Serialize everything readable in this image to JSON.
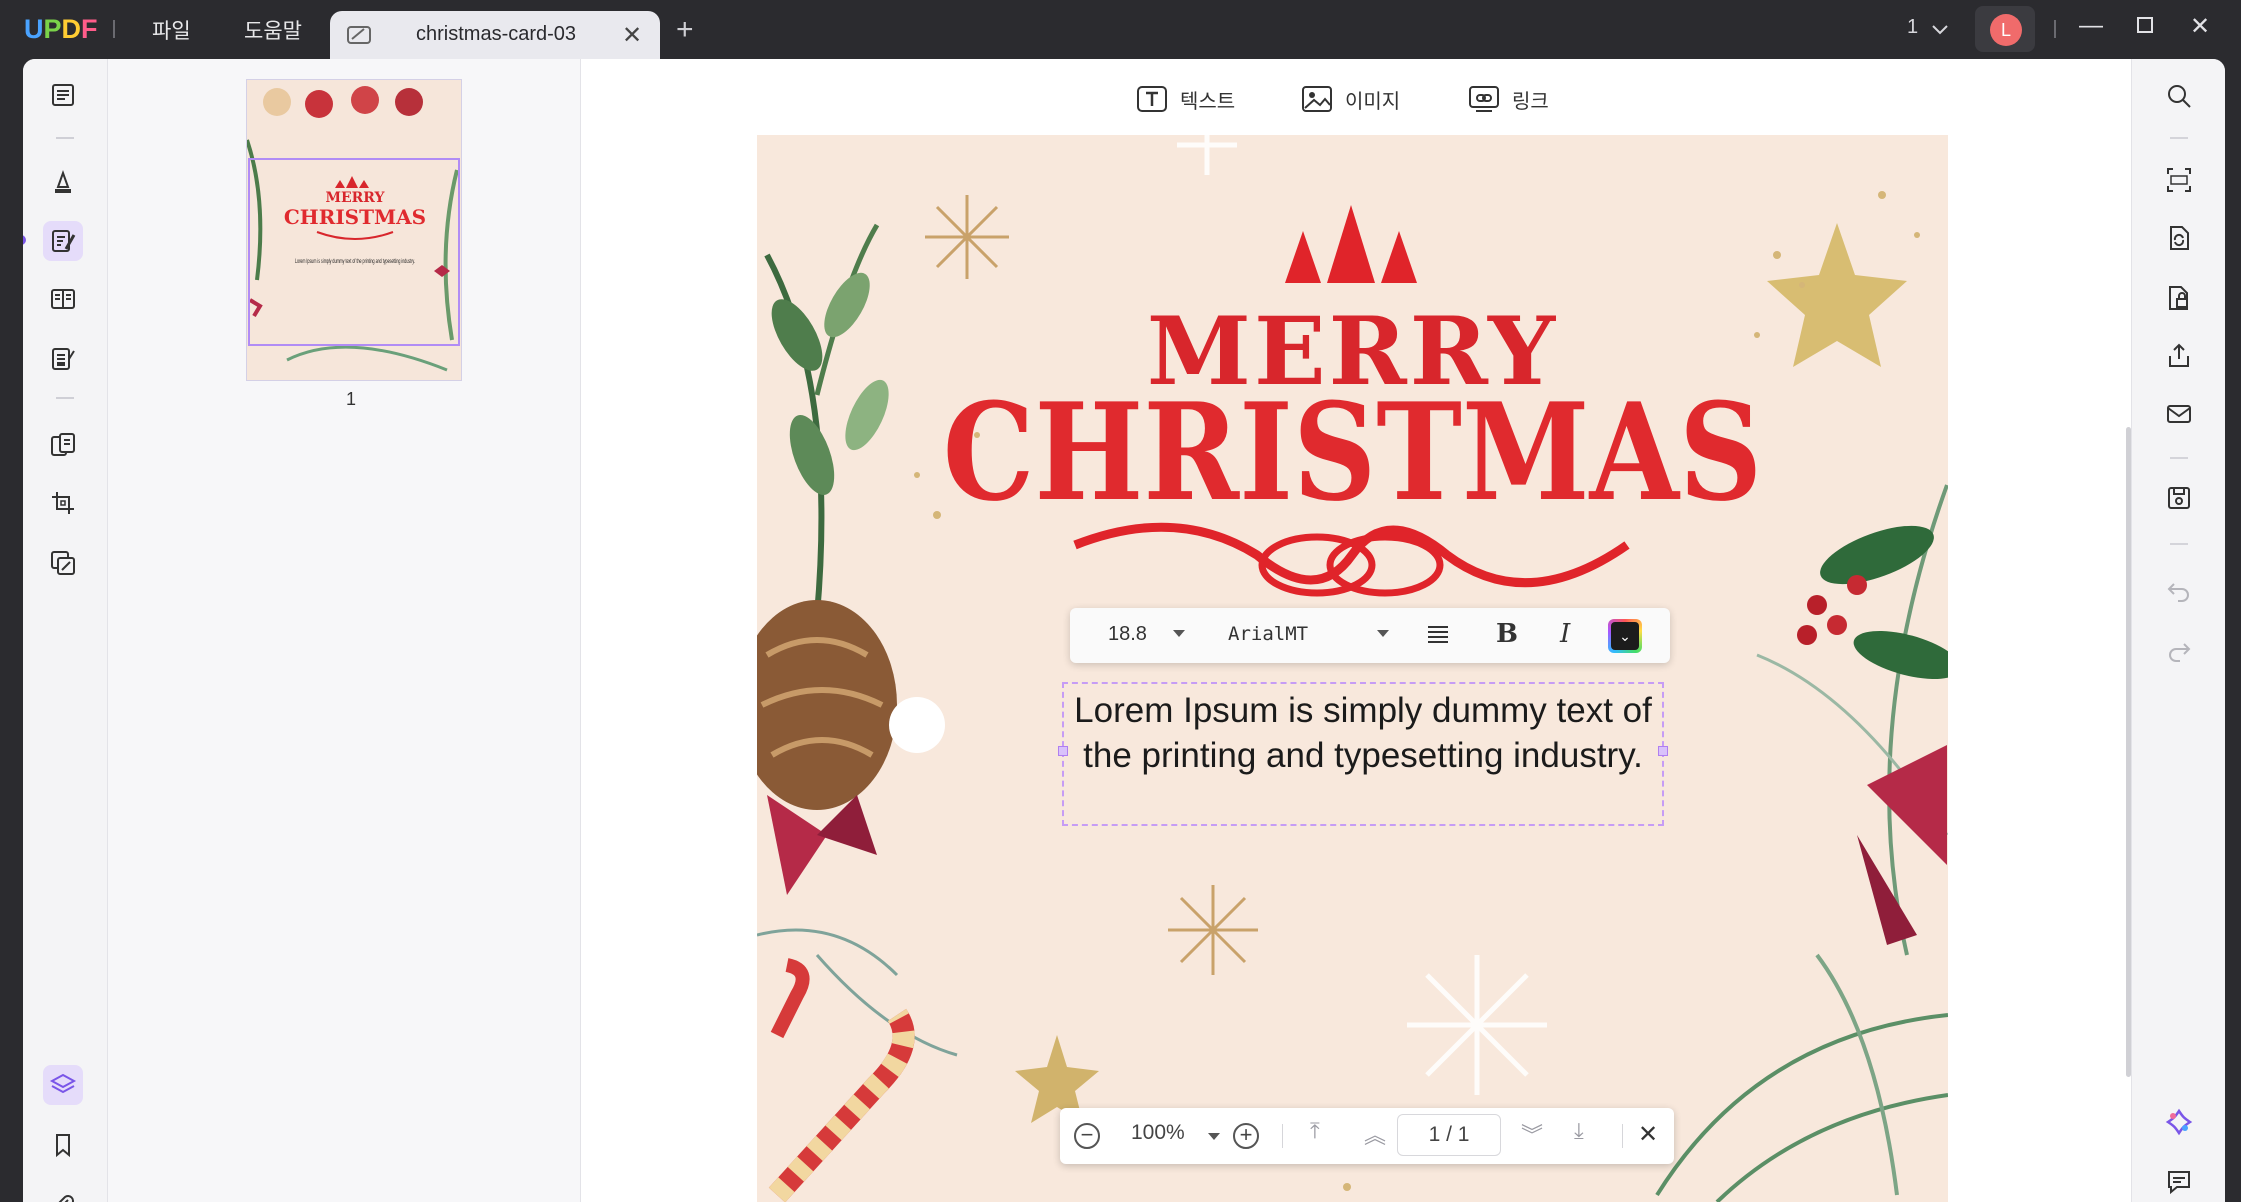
{
  "app": {
    "logo": "UPDF"
  },
  "menu": {
    "file": "파일",
    "help": "도움말"
  },
  "tab": {
    "title": "christmas-card-03"
  },
  "titlebar": {
    "page_indicator": "1",
    "avatar_initial": "L"
  },
  "doc_toolbar": {
    "text_label": "텍스트",
    "image_label": "이미지",
    "link_label": "링크"
  },
  "thumbnail": {
    "page_number": "1",
    "merry": "MERRY",
    "christmas": "CHRISTMAS",
    "body": "Lorem Ipsum is simply dummy text of the printing and typesetting industry."
  },
  "card": {
    "merry": "MERRY",
    "christmas": "CHRISTMAS"
  },
  "textbox": {
    "text": "Lorem Ipsum is simply dummy text of the printing and typesetting industry."
  },
  "format_bar": {
    "font_size": "18.8",
    "font_name": "ArialMT",
    "bold_label": "B",
    "italic_label": "I"
  },
  "zoom_bar": {
    "zoom": "100%",
    "page": "1 / 1"
  },
  "colors": {
    "accent": "#7a56e8",
    "card_red": "#e02a2e",
    "card_bg": "#f8e8dc"
  }
}
